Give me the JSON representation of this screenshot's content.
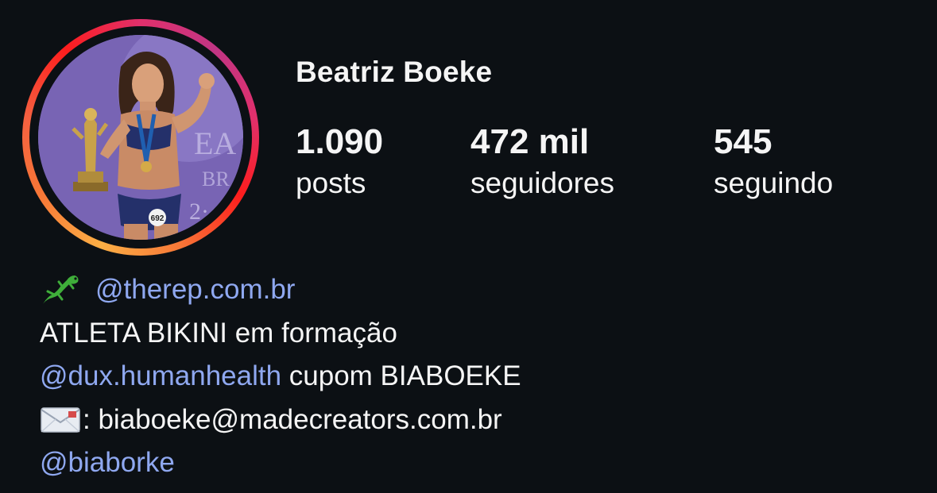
{
  "profile": {
    "username": "Beatriz Boeke",
    "avatar_badge_number": "692"
  },
  "stats": {
    "posts": {
      "value": "1.090",
      "label": "posts"
    },
    "followers": {
      "value": "472 mil",
      "label": "seguidores"
    },
    "following": {
      "value": "545",
      "label": "seguindo"
    }
  },
  "bio": {
    "line1_link": "@therep.com.br",
    "line1_icon": "lizard-icon",
    "line2_text": "ATLETA BIKINI em formação",
    "line3_link": "@dux.humanhealth",
    "line3_text": " cupom BIABOEKE",
    "line4_icon": "envelope-icon",
    "line4_text": ": biaboeke@madecreators.com.br",
    "line5_link": "@biaborke"
  },
  "colors": {
    "background": "#0c1014",
    "text": "#f5f5f5",
    "link": "#8fa8f0",
    "ring_gradient": [
      "#fcaf45",
      "#f77737",
      "#fd1d1d",
      "#e1306c",
      "#c13584"
    ]
  }
}
